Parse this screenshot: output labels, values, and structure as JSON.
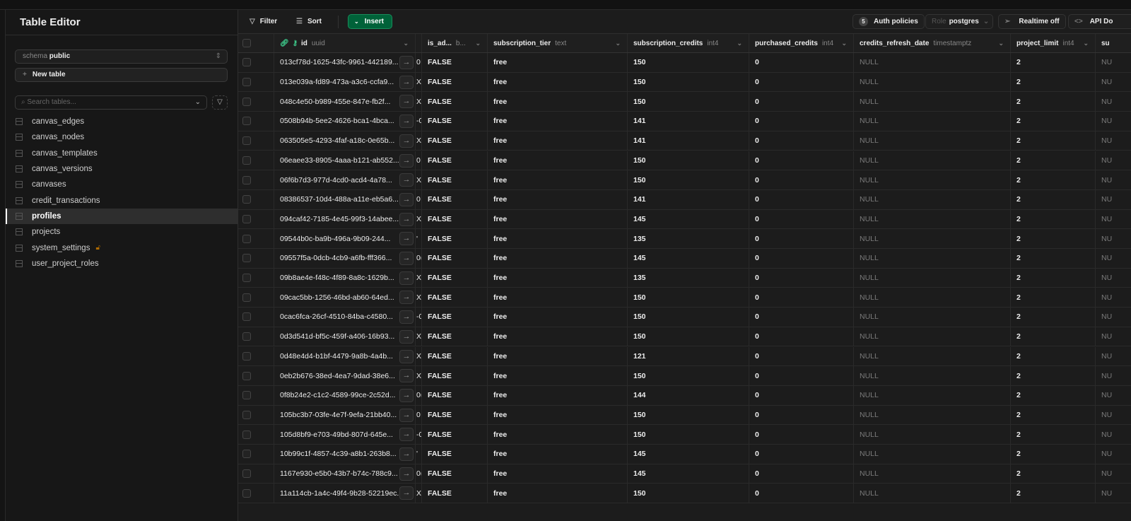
{
  "sidebar": {
    "title": "Table Editor",
    "schema_label": "schema",
    "schema_value": "public",
    "new_table": "New table",
    "search_placeholder": "Search tables...",
    "tables": [
      {
        "name": "canvas_edges"
      },
      {
        "name": "canvas_nodes"
      },
      {
        "name": "canvas_templates"
      },
      {
        "name": "canvas_versions"
      },
      {
        "name": "canvases"
      },
      {
        "name": "credit_transactions"
      },
      {
        "name": "profiles",
        "active": true
      },
      {
        "name": "projects"
      },
      {
        "name": "system_settings",
        "locked": true
      },
      {
        "name": "user_project_roles"
      }
    ]
  },
  "toolbar": {
    "filter": "Filter",
    "sort": "Sort",
    "insert": "Insert",
    "auth_count": "5",
    "auth_policies": "Auth policies",
    "role_label": "Role",
    "role_value": "postgres",
    "realtime": "Realtime off",
    "api_docs": "API Do"
  },
  "columns": [
    {
      "name": "id",
      "type": "uuid"
    },
    {
      "name": "is_ad...",
      "type": "b..."
    },
    {
      "name": "subscription_tier",
      "type": "text"
    },
    {
      "name": "subscription_credits",
      "type": "int4"
    },
    {
      "name": "purchased_credits",
      "type": "int4"
    },
    {
      "name": "credits_refresh_date",
      "type": "timestamptz"
    },
    {
      "name": "project_limit",
      "type": "int4"
    },
    {
      "name": "su",
      "type": ""
    }
  ],
  "rows": [
    {
      "id": "013cf78d-1625-43fc-9961-442189...",
      "frag": "0",
      "is_admin": "FALSE",
      "tier": "free",
      "credits": "150",
      "purchased": "0",
      "refresh": "NULL",
      "limit": "2",
      "next": "NU"
    },
    {
      "id": "013e039a-fd89-473a-a3c6-ccfa9...",
      "frag": "X",
      "is_admin": "FALSE",
      "tier": "free",
      "credits": "150",
      "purchased": "0",
      "refresh": "NULL",
      "limit": "2",
      "next": "NU"
    },
    {
      "id": "048c4e50-b989-455e-847e-fb2f...",
      "frag": "X",
      "is_admin": "FALSE",
      "tier": "free",
      "credits": "150",
      "purchased": "0",
      "refresh": "NULL",
      "limit": "2",
      "next": "NU"
    },
    {
      "id": "0508b94b-5ee2-4626-bca1-4bca...",
      "frag": "-0",
      "is_admin": "FALSE",
      "tier": "free",
      "credits": "141",
      "purchased": "0",
      "refresh": "NULL",
      "limit": "2",
      "next": "NU"
    },
    {
      "id": "063505e5-4293-4faf-a18c-0e65b...",
      "frag": "X",
      "is_admin": "FALSE",
      "tier": "free",
      "credits": "141",
      "purchased": "0",
      "refresh": "NULL",
      "limit": "2",
      "next": "NU"
    },
    {
      "id": "06eaee33-8905-4aaa-b121-ab552...",
      "frag": "0",
      "is_admin": "FALSE",
      "tier": "free",
      "credits": "150",
      "purchased": "0",
      "refresh": "NULL",
      "limit": "2",
      "next": "NU"
    },
    {
      "id": "06f6b7d3-977d-4cd0-acd4-4a78...",
      "frag": "X",
      "is_admin": "FALSE",
      "tier": "free",
      "credits": "150",
      "purchased": "0",
      "refresh": "NULL",
      "limit": "2",
      "next": "NU"
    },
    {
      "id": "08386537-10d4-488a-a11e-eb5a6...",
      "frag": "0",
      "is_admin": "FALSE",
      "tier": "free",
      "credits": "141",
      "purchased": "0",
      "refresh": "NULL",
      "limit": "2",
      "next": "NU"
    },
    {
      "id": "094caf42-7185-4e45-99f3-14abee...",
      "frag": "X",
      "is_admin": "FALSE",
      "tier": "free",
      "credits": "145",
      "purchased": "0",
      "refresh": "NULL",
      "limit": "2",
      "next": "NU"
    },
    {
      "id": "09544b0c-ba9b-496a-9b09-244...",
      "frag": "'",
      "is_admin": "FALSE",
      "tier": "free",
      "credits": "135",
      "purchased": "0",
      "refresh": "NULL",
      "limit": "2",
      "next": "NU"
    },
    {
      "id": "09557f5a-0dcb-4cb9-a6fb-fff366...",
      "frag": "0(",
      "is_admin": "FALSE",
      "tier": "free",
      "credits": "145",
      "purchased": "0",
      "refresh": "NULL",
      "limit": "2",
      "next": "NU"
    },
    {
      "id": "09b8ae4e-f48c-4f89-8a8c-1629b...",
      "frag": "X",
      "is_admin": "FALSE",
      "tier": "free",
      "credits": "135",
      "purchased": "0",
      "refresh": "NULL",
      "limit": "2",
      "next": "NU"
    },
    {
      "id": "09cac5bb-1256-46bd-ab60-64ed...",
      "frag": "X",
      "is_admin": "FALSE",
      "tier": "free",
      "credits": "150",
      "purchased": "0",
      "refresh": "NULL",
      "limit": "2",
      "next": "NU"
    },
    {
      "id": "0cac6fca-26cf-4510-84ba-c4580...",
      "frag": "-0",
      "is_admin": "FALSE",
      "tier": "free",
      "credits": "150",
      "purchased": "0",
      "refresh": "NULL",
      "limit": "2",
      "next": "NU"
    },
    {
      "id": "0d3d541d-bf5c-459f-a406-16b93...",
      "frag": "X",
      "is_admin": "FALSE",
      "tier": "free",
      "credits": "150",
      "purchased": "0",
      "refresh": "NULL",
      "limit": "2",
      "next": "NU"
    },
    {
      "id": "0d48e4d4-b1bf-4479-9a8b-4a4b...",
      "frag": "X",
      "is_admin": "FALSE",
      "tier": "free",
      "credits": "121",
      "purchased": "0",
      "refresh": "NULL",
      "limit": "2",
      "next": "NU"
    },
    {
      "id": "0eb2b676-38ed-4ea7-9dad-38e6...",
      "frag": "X",
      "is_admin": "FALSE",
      "tier": "free",
      "credits": "150",
      "purchased": "0",
      "refresh": "NULL",
      "limit": "2",
      "next": "NU"
    },
    {
      "id": "0f8b24e2-c1c2-4589-99ce-2c52d...",
      "frag": "0(",
      "is_admin": "FALSE",
      "tier": "free",
      "credits": "144",
      "purchased": "0",
      "refresh": "NULL",
      "limit": "2",
      "next": "NU"
    },
    {
      "id": "105bc3b7-03fe-4e7f-9efa-21bb40...",
      "frag": "0",
      "is_admin": "FALSE",
      "tier": "free",
      "credits": "150",
      "purchased": "0",
      "refresh": "NULL",
      "limit": "2",
      "next": "NU"
    },
    {
      "id": "105d8bf9-e703-49bd-807d-645e...",
      "frag": "-0",
      "is_admin": "FALSE",
      "tier": "free",
      "credits": "150",
      "purchased": "0",
      "refresh": "NULL",
      "limit": "2",
      "next": "NU"
    },
    {
      "id": "10b99c1f-4857-4c39-a8b1-263b8...",
      "frag": "'",
      "is_admin": "FALSE",
      "tier": "free",
      "credits": "145",
      "purchased": "0",
      "refresh": "NULL",
      "limit": "2",
      "next": "NU"
    },
    {
      "id": "1167e930-e5b0-43b7-b74c-788c9...",
      "frag": "0(",
      "is_admin": "FALSE",
      "tier": "free",
      "credits": "145",
      "purchased": "0",
      "refresh": "NULL",
      "limit": "2",
      "next": "NU"
    },
    {
      "id": "11a114cb-1a4c-49f4-9b28-52219ec...",
      "frag": "X",
      "is_admin": "FALSE",
      "tier": "free",
      "credits": "150",
      "purchased": "0",
      "refresh": "NULL",
      "limit": "2",
      "next": "NU"
    }
  ]
}
